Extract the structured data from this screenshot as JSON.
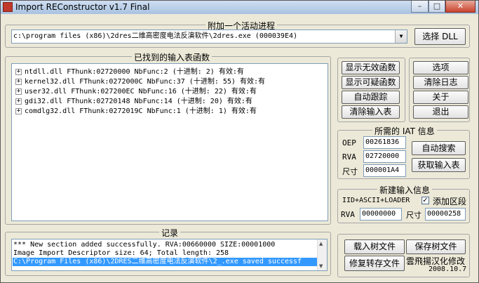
{
  "window": {
    "title": "Import REConstructor v1.7 Final"
  },
  "process_group": {
    "legend": "附加一个活动进程",
    "selected_process": "c:\\program files (x86)\\2dres二维高密度电法反演软件\\2dres.exe (000039E4)",
    "select_dll_label": "选择 DLL"
  },
  "imports_group": {
    "legend": "已找到的输入表函数",
    "items": [
      "ntdll.dll FThunk:02720000 NbFunc:2 (十进制: 2) 有效:有",
      "kernel32.dll FThunk:0272000C NbFunc:37 (十进制: 55) 有效:有",
      "user32.dll FThunk:027200EC NbFunc:16 (十进制: 22) 有效:有",
      "gdi32.dll FThunk:02720148 NbFunc:14 (十进制: 20) 有效:有",
      "comdlg32.dll FThunk:0272019C NbFunc:1 (十进制: 1) 有效:有"
    ]
  },
  "side_buttons": {
    "show_invalid": "显示无效函数",
    "show_suspect": "显示可疑函数",
    "auto_trace": "自动跟踪",
    "clear_imports": "清除输入表",
    "options": "选项",
    "clear_log": "清除日志",
    "about": "关于",
    "exit": "退出"
  },
  "iat_group": {
    "legend": "所需的 IAT 信息",
    "oep_label": "OEP",
    "oep_value": "00261836",
    "rva_label": "RVA",
    "rva_value": "02720000",
    "size_label": "尺寸",
    "size_value": "000001A4",
    "auto_search": "自动搜索",
    "get_imports": "获取输入表"
  },
  "new_import_group": {
    "legend": "新建输入信息",
    "header_text": "IID+ASCII+LOADER",
    "add_section_label": "添加区段",
    "add_section_checked": true,
    "rva_label": "RVA",
    "rva_value": "00000000",
    "size_label": "尺寸",
    "size_value": "00000258"
  },
  "log_group": {
    "legend": "记录",
    "lines": [
      "*** New section added successfully. RVA:00660000 SIZE:00001000",
      "Image Import Descriptor size: 64; Total length: 258",
      "C:\\Program Files (x86)\\2DRES二维高密度电法反演软件\\2_.exe saved successf"
    ]
  },
  "bottom_buttons": {
    "load_tree": "载入树文件",
    "save_tree": "保存树文件",
    "fix_dump": "修复转存文件"
  },
  "credits": {
    "author": "雲飛揚汉化修改",
    "date": "2008.10.7"
  }
}
